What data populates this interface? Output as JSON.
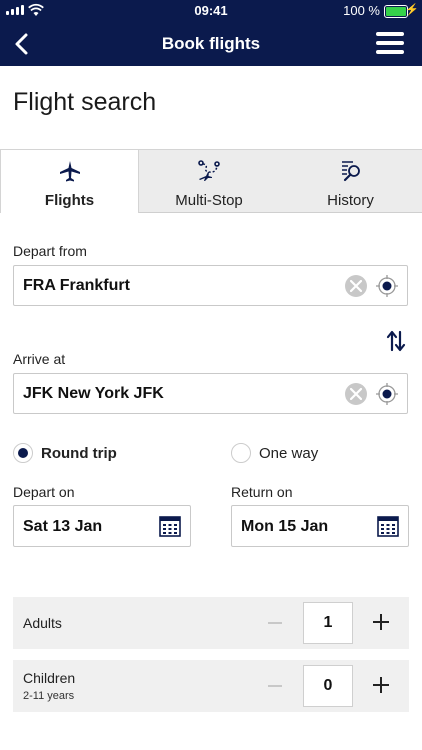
{
  "status_bar": {
    "time": "09:41",
    "battery": "100 %"
  },
  "header": {
    "title": "Book flights"
  },
  "page_title": "Flight search",
  "tabs": [
    {
      "label": "Flights",
      "icon": "plane-icon",
      "active": true
    },
    {
      "label": "Multi-Stop",
      "icon": "multi-stop-route-icon",
      "active": false
    },
    {
      "label": "History",
      "icon": "history-search-icon",
      "active": false
    }
  ],
  "depart_from": {
    "label": "Depart from",
    "value": "FRA Frankfurt"
  },
  "arrive_at": {
    "label": "Arrive at",
    "value": "JFK New York JFK"
  },
  "trip_type": {
    "round_trip": "Round trip",
    "one_way": "One way",
    "selected": "round_trip"
  },
  "depart_on": {
    "label": "Depart on",
    "value": "Sat 13 Jan"
  },
  "return_on": {
    "label": "Return on",
    "value": "Mon 15 Jan"
  },
  "passengers": {
    "adults": {
      "label": "Adults",
      "count": "1"
    },
    "children": {
      "label": "Children",
      "sublabel": "2-11 years",
      "count": "0"
    }
  },
  "colors": {
    "brand_navy": "#0b1a4d",
    "battery_green": "#35d14a"
  }
}
